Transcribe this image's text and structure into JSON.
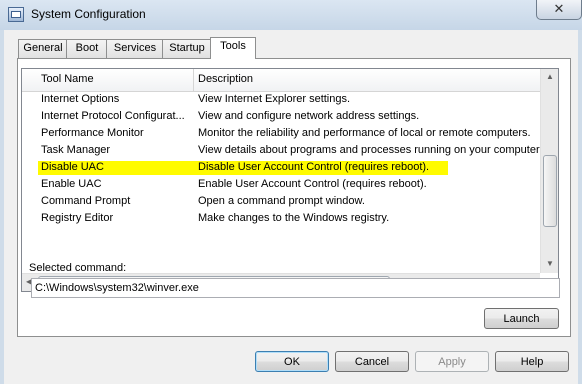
{
  "window": {
    "title": "System Configuration",
    "close_icon": "close-icon"
  },
  "tabs": [
    "General",
    "Boot",
    "Services",
    "Startup",
    "Tools"
  ],
  "active_tab": "Tools",
  "table": {
    "columns": [
      "Tool Name",
      "Description"
    ],
    "rows": [
      {
        "name": "Internet Options",
        "desc": "View Internet Explorer settings."
      },
      {
        "name": "Internet Protocol Configurat...",
        "desc": "View and configure network address settings."
      },
      {
        "name": "Performance Monitor",
        "desc": "Monitor the reliability and performance of local or remote computers."
      },
      {
        "name": "Task Manager",
        "desc": "View details about programs and processes running on your computer."
      },
      {
        "name": "Disable UAC",
        "desc": "Disable User Account Control (requires reboot)."
      },
      {
        "name": "Enable UAC",
        "desc": "Enable User Account Control (requires reboot)."
      },
      {
        "name": "Command Prompt",
        "desc": "Open a command prompt window."
      },
      {
        "name": "Registry Editor",
        "desc": "Make changes to the Windows registry."
      }
    ],
    "highlighted_row": "Disable UAC",
    "highlight_color": "#fffb00"
  },
  "selected_command": {
    "label": "Selected command:",
    "value": "C:\\Windows\\system32\\winver.exe"
  },
  "buttons": {
    "launch": "Launch",
    "ok": "OK",
    "cancel": "Cancel",
    "apply": "Apply",
    "help": "Help"
  }
}
